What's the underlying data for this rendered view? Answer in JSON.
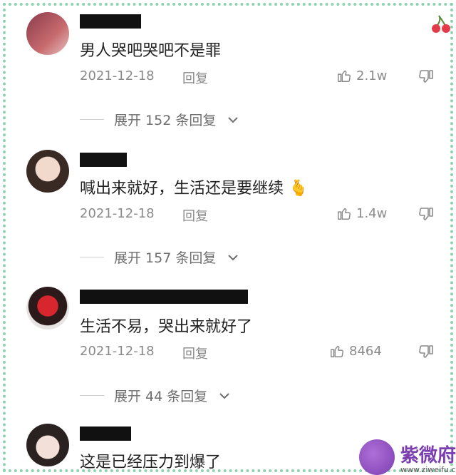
{
  "comments": [
    {
      "text": "男人哭吧哭吧不是罪",
      "date": "2021-12-18",
      "reply_label": "回复",
      "likes": "2.1w",
      "expand": "展开 152 条回复"
    },
    {
      "text": "喊出来就好，生活还是要继续",
      "emoji": "🫰",
      "date": "2021-12-18",
      "reply_label": "回复",
      "likes": "1.4w",
      "expand": "展开 157 条回复"
    },
    {
      "text": "生活不易，哭出来就好了",
      "date": "2021-12-18",
      "reply_label": "回复",
      "likes": "8464",
      "expand": "展开 44 条回复"
    },
    {
      "text": "这是已经压力到爆了"
    }
  ],
  "watermark": {
    "title": "紫微府",
    "url": "www.ziweifu.com"
  },
  "colors": {
    "meta_gray": "#8a8a8a",
    "frame_green": "#8fd2b0",
    "watermark_purple": "#7b3fb0"
  }
}
